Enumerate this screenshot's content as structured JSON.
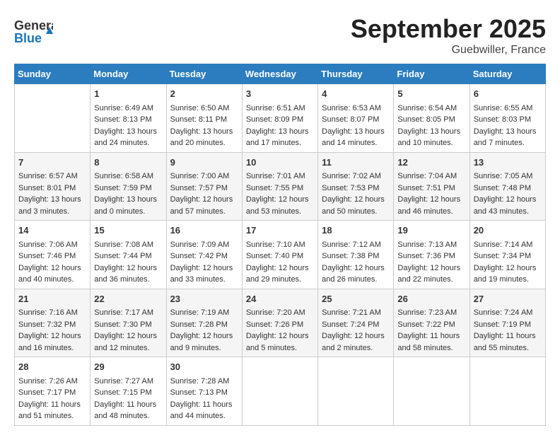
{
  "header": {
    "logo_general": "General",
    "logo_blue": "Blue",
    "month": "September 2025",
    "location": "Guebwiller, France"
  },
  "weekdays": [
    "Sunday",
    "Monday",
    "Tuesday",
    "Wednesday",
    "Thursday",
    "Friday",
    "Saturday"
  ],
  "weeks": [
    [
      {
        "day": "",
        "content": ""
      },
      {
        "day": "1",
        "content": "Sunrise: 6:49 AM\nSunset: 8:13 PM\nDaylight: 13 hours\nand 24 minutes."
      },
      {
        "day": "2",
        "content": "Sunrise: 6:50 AM\nSunset: 8:11 PM\nDaylight: 13 hours\nand 20 minutes."
      },
      {
        "day": "3",
        "content": "Sunrise: 6:51 AM\nSunset: 8:09 PM\nDaylight: 13 hours\nand 17 minutes."
      },
      {
        "day": "4",
        "content": "Sunrise: 6:53 AM\nSunset: 8:07 PM\nDaylight: 13 hours\nand 14 minutes."
      },
      {
        "day": "5",
        "content": "Sunrise: 6:54 AM\nSunset: 8:05 PM\nDaylight: 13 hours\nand 10 minutes."
      },
      {
        "day": "6",
        "content": "Sunrise: 6:55 AM\nSunset: 8:03 PM\nDaylight: 13 hours\nand 7 minutes."
      }
    ],
    [
      {
        "day": "7",
        "content": "Sunrise: 6:57 AM\nSunset: 8:01 PM\nDaylight: 13 hours\nand 3 minutes."
      },
      {
        "day": "8",
        "content": "Sunrise: 6:58 AM\nSunset: 7:59 PM\nDaylight: 13 hours\nand 0 minutes."
      },
      {
        "day": "9",
        "content": "Sunrise: 7:00 AM\nSunset: 7:57 PM\nDaylight: 12 hours\nand 57 minutes."
      },
      {
        "day": "10",
        "content": "Sunrise: 7:01 AM\nSunset: 7:55 PM\nDaylight: 12 hours\nand 53 minutes."
      },
      {
        "day": "11",
        "content": "Sunrise: 7:02 AM\nSunset: 7:53 PM\nDaylight: 12 hours\nand 50 minutes."
      },
      {
        "day": "12",
        "content": "Sunrise: 7:04 AM\nSunset: 7:51 PM\nDaylight: 12 hours\nand 46 minutes."
      },
      {
        "day": "13",
        "content": "Sunrise: 7:05 AM\nSunset: 7:48 PM\nDaylight: 12 hours\nand 43 minutes."
      }
    ],
    [
      {
        "day": "14",
        "content": "Sunrise: 7:06 AM\nSunset: 7:46 PM\nDaylight: 12 hours\nand 40 minutes."
      },
      {
        "day": "15",
        "content": "Sunrise: 7:08 AM\nSunset: 7:44 PM\nDaylight: 12 hours\nand 36 minutes."
      },
      {
        "day": "16",
        "content": "Sunrise: 7:09 AM\nSunset: 7:42 PM\nDaylight: 12 hours\nand 33 minutes."
      },
      {
        "day": "17",
        "content": "Sunrise: 7:10 AM\nSunset: 7:40 PM\nDaylight: 12 hours\nand 29 minutes."
      },
      {
        "day": "18",
        "content": "Sunrise: 7:12 AM\nSunset: 7:38 PM\nDaylight: 12 hours\nand 26 minutes."
      },
      {
        "day": "19",
        "content": "Sunrise: 7:13 AM\nSunset: 7:36 PM\nDaylight: 12 hours\nand 22 minutes."
      },
      {
        "day": "20",
        "content": "Sunrise: 7:14 AM\nSunset: 7:34 PM\nDaylight: 12 hours\nand 19 minutes."
      }
    ],
    [
      {
        "day": "21",
        "content": "Sunrise: 7:16 AM\nSunset: 7:32 PM\nDaylight: 12 hours\nand 16 minutes."
      },
      {
        "day": "22",
        "content": "Sunrise: 7:17 AM\nSunset: 7:30 PM\nDaylight: 12 hours\nand 12 minutes."
      },
      {
        "day": "23",
        "content": "Sunrise: 7:19 AM\nSunset: 7:28 PM\nDaylight: 12 hours\nand 9 minutes."
      },
      {
        "day": "24",
        "content": "Sunrise: 7:20 AM\nSunset: 7:26 PM\nDaylight: 12 hours\nand 5 minutes."
      },
      {
        "day": "25",
        "content": "Sunrise: 7:21 AM\nSunset: 7:24 PM\nDaylight: 12 hours\nand 2 minutes."
      },
      {
        "day": "26",
        "content": "Sunrise: 7:23 AM\nSunset: 7:22 PM\nDaylight: 11 hours\nand 58 minutes."
      },
      {
        "day": "27",
        "content": "Sunrise: 7:24 AM\nSunset: 7:19 PM\nDaylight: 11 hours\nand 55 minutes."
      }
    ],
    [
      {
        "day": "28",
        "content": "Sunrise: 7:26 AM\nSunset: 7:17 PM\nDaylight: 11 hours\nand 51 minutes."
      },
      {
        "day": "29",
        "content": "Sunrise: 7:27 AM\nSunset: 7:15 PM\nDaylight: 11 hours\nand 48 minutes."
      },
      {
        "day": "30",
        "content": "Sunrise: 7:28 AM\nSunset: 7:13 PM\nDaylight: 11 hours\nand 44 minutes."
      },
      {
        "day": "",
        "content": ""
      },
      {
        "day": "",
        "content": ""
      },
      {
        "day": "",
        "content": ""
      },
      {
        "day": "",
        "content": ""
      }
    ]
  ]
}
